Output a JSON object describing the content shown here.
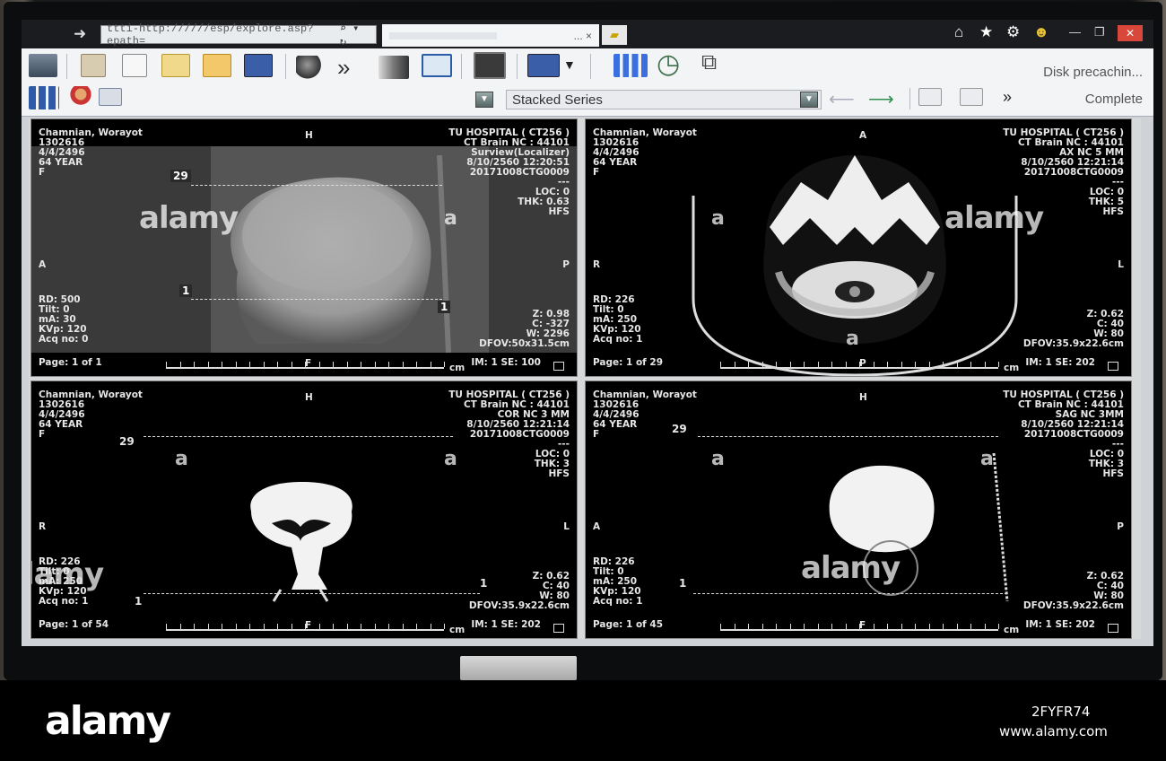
{
  "browser": {
    "address": "ttti-http://////esp/explore.asp?epath=",
    "tab_title": "... ×"
  },
  "toolbar": {
    "dropdown_value": "Stacked Series",
    "status_line1": "Disk precachin...",
    "status_line2": "Complete"
  },
  "panes": [
    {
      "patient": {
        "name": "Chamnian, Worayot",
        "id": "1302616",
        "dob": "4/4/2496",
        "age": "64 YEAR",
        "sex": "F"
      },
      "study": {
        "hospital": "TU HOSPITAL ( CT256 )",
        "exam": "CT Brain NC  :  44101",
        "series": "Surview(Localizer)",
        "datetime": "8/10/2560 12:20:51",
        "accession": "20171008CTG0009",
        "dashes": "---"
      },
      "pos": {
        "loc": "LOC: 0",
        "thk": "THK: 0.63",
        "hfs": "HFS"
      },
      "scan": {
        "rd": "RD: 500",
        "tilt": "Tilt: 0",
        "ma": "mA: 30",
        "kvp": "KVp: 120",
        "acq": "Acq no: 0"
      },
      "window": {
        "z": "Z: 0.98",
        "c": "C: -327",
        "w": "W: 2296",
        "dfov": "DFOV:50x31.5cm"
      },
      "footer": {
        "page": "Page: 1 of 1",
        "im": "IM: 1 SE: 100",
        "cm": "cm"
      },
      "orient": {
        "top": "H",
        "left": "A",
        "right": "P",
        "bottom": "F"
      },
      "markers": {
        "a": "29",
        "b": "1",
        "c": "1"
      }
    },
    {
      "patient": {
        "name": "Chamnian, Worayot",
        "id": "1302616",
        "dob": "4/4/2496",
        "age": "64 YEAR",
        "sex": "F"
      },
      "study": {
        "hospital": "TU HOSPITAL ( CT256 )",
        "exam": "CT Brain NC  :  44101",
        "series": "AX NC 5 MM",
        "datetime": "8/10/2560 12:21:14",
        "accession": "20171008CTG0009",
        "dashes": "---"
      },
      "pos": {
        "loc": "LOC: 0",
        "thk": "THK: 5",
        "hfs": "HFS"
      },
      "scan": {
        "rd": "RD: 226",
        "tilt": "Tilt: 0",
        "ma": "mA: 250",
        "kvp": "KVp: 120",
        "acq": "Acq no: 1"
      },
      "window": {
        "z": "Z: 0.62",
        "c": "C: 40",
        "w": "W: 80",
        "dfov": "DFOV:35.9x22.6cm"
      },
      "footer": {
        "page": "Page: 1 of 29",
        "im": "IM: 1 SE: 202",
        "cm": "cm"
      },
      "orient": {
        "top": "A",
        "left": "R",
        "right": "L",
        "bottom": "P"
      }
    },
    {
      "patient": {
        "name": "Chamnian, Worayot",
        "id": "1302616",
        "dob": "4/4/2496",
        "age": "64 YEAR",
        "sex": "F"
      },
      "study": {
        "hospital": "TU HOSPITAL ( CT256 )",
        "exam": "CT Brain NC  :  44101",
        "series": "COR NC 3 MM",
        "datetime": "8/10/2560 12:21:14",
        "accession": "20171008CTG0009",
        "dashes": "---"
      },
      "pos": {
        "loc": "LOC: 0",
        "thk": "THK: 3",
        "hfs": "HFS"
      },
      "scan": {
        "rd": "RD: 226",
        "tilt": "Tilt: 0",
        "ma": "mA: 250",
        "kvp": "KVp: 120",
        "acq": "Acq no: 1"
      },
      "window": {
        "z": "Z: 0.62",
        "c": "C: 40",
        "w": "W: 80",
        "dfov": "DFOV:35.9x22.6cm"
      },
      "footer": {
        "page": "Page: 1 of 54",
        "im": "IM: 1 SE: 202",
        "cm": "cm"
      },
      "orient": {
        "top": "H",
        "left": "R",
        "right": "L",
        "bottom": "F"
      },
      "markers": {
        "a": "29",
        "b": "1",
        "c": "1"
      }
    },
    {
      "patient": {
        "name": "Chamnian, Worayot",
        "id": "1302616",
        "dob": "4/4/2496",
        "age": "64 YEAR",
        "sex": "F"
      },
      "study": {
        "hospital": "TU HOSPITAL ( CT256 )",
        "exam": "CT Brain NC  :  44101",
        "series": "SAG NC 3MM",
        "datetime": "8/10/2560 12:21:14",
        "accession": "20171008CTG0009",
        "dashes": "---"
      },
      "pos": {
        "loc": "LOC: 0",
        "thk": "THK: 3",
        "hfs": "HFS"
      },
      "scan": {
        "rd": "RD: 226",
        "tilt": "Tilt: 0",
        "ma": "mA: 250",
        "kvp": "KVp: 120",
        "acq": "Acq no: 1"
      },
      "window": {
        "z": "Z: 0.62",
        "c": "C: 40",
        "w": "W: 80",
        "dfov": "DFOV:35.9x22.6cm"
      },
      "footer": {
        "page": "Page: 1 of 45",
        "im": "IM: 1 SE: 202",
        "cm": "cm"
      },
      "orient": {
        "top": "H",
        "left": "A",
        "right": "P",
        "bottom": "F"
      },
      "markers": {
        "a": "29",
        "b": "1"
      }
    }
  ],
  "watermark": {
    "text": "alamy",
    "small": "a"
  },
  "caption": {
    "logo": "alamy",
    "image_id": "2FYFR74",
    "site": "www.alamy.com"
  }
}
